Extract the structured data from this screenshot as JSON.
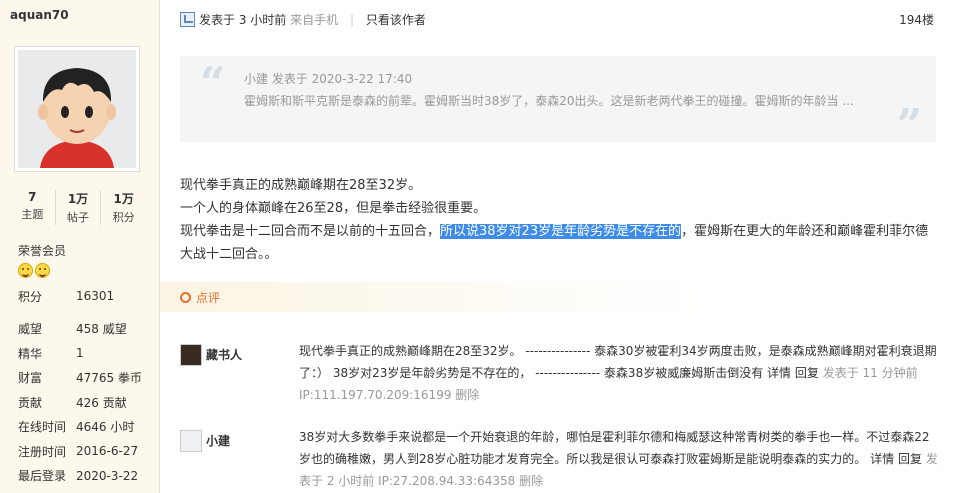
{
  "user": {
    "name": "aquan70",
    "stats": [
      {
        "num": "7",
        "label": "主题"
      },
      {
        "num": "1万",
        "label": "帖子"
      },
      {
        "num": "1万",
        "label": "积分"
      }
    ],
    "honor": "荣誉会员",
    "info": [
      {
        "k": "积分",
        "v": "16301"
      },
      {
        "k": "威望",
        "v": "458 威望"
      },
      {
        "k": "精华",
        "v": "1"
      },
      {
        "k": "财富",
        "v": "47765 拳币"
      },
      {
        "k": "贡献",
        "v": "426 贡献"
      },
      {
        "k": "在线时间",
        "v": "4646 小时"
      },
      {
        "k": "注册时间",
        "v": "2016-6-27"
      },
      {
        "k": "最后登录",
        "v": "2020-3-22"
      }
    ]
  },
  "post": {
    "posted": "发表于 3 小时前",
    "source": "来自手机",
    "only_author": "只看该作者",
    "floor": "194楼",
    "quote": {
      "head": "小建 发表于 2020-3-22 17:40",
      "body": "霍姆斯和斯平克斯是泰森的前辈。霍姆斯当时38岁了，泰森20出头。这是新老两代拳王的碰撞。霍姆斯的年龄当 ..."
    },
    "lines": [
      "现代拳手真正的成熟巅峰期在28至32岁。",
      "一个人的身体巅峰在26至28，但是拳击经验很重要。"
    ],
    "line3_pre": "现代拳击是十二回合而不是以前的十五回合，",
    "line3_hl": "所以说38岁对23岁是年龄劣势是不存在的",
    "line3_post": "，霍姆斯在更大的年龄还和巅峰霍利菲尔德大战十二回合。。"
  },
  "comments_title": "点评",
  "comments": [
    {
      "name": "藏书人",
      "text": "现代拳手真正的成熟巅峰期在28至32岁。 --------------- 泰森30岁被霍利34岁两度击败，是泰森成熟巅峰期对霍利衰退期了：） 38岁对23岁是年龄劣势是不存在的， --------------- 泰森38岁被威廉姆斯击倒没有",
      "detail": "详情",
      "reply": "回复",
      "time": "发表于 11 分钟前",
      "ip": "IP:111.197.70.209:16199",
      "delete": "删除"
    },
    {
      "name": "小建",
      "text": "38岁对大多数拳手来说都是一个开始衰退的年龄，哪怕是霍利菲尔德和梅威瑟这种常青树类的拳手也一样。不过泰森22岁也的确稚嫩，男人到28岁心脏功能才发育完全。所以我是很认可泰森打败霍姆斯是能说明泰森的实力的。",
      "detail": "详情",
      "reply": "回复",
      "time": "发表于 2 小时前",
      "ip": "IP:27.208.94.33:64358",
      "delete": "删除"
    }
  ]
}
